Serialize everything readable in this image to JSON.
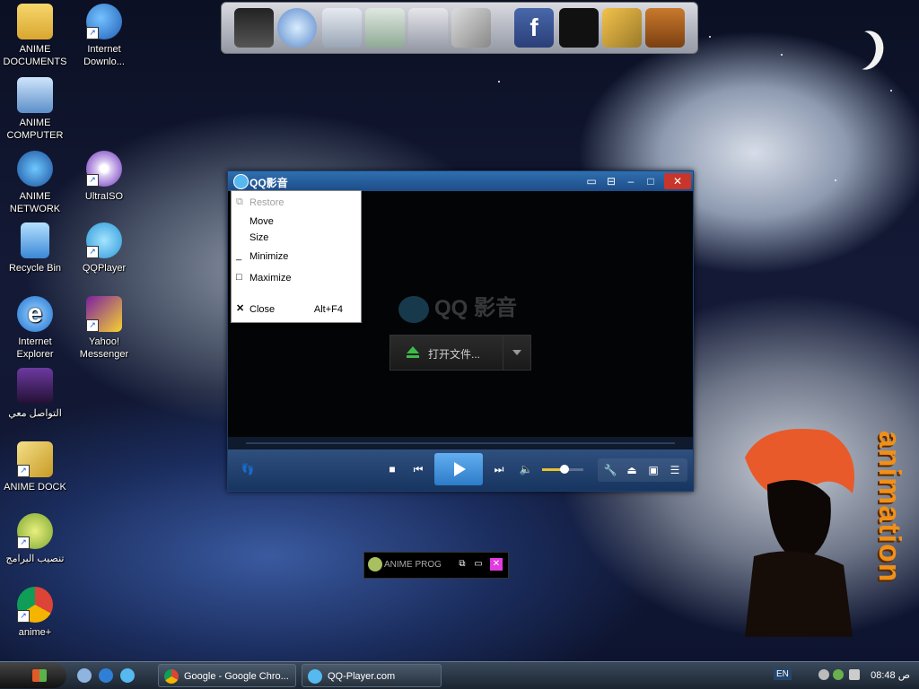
{
  "desktop": {
    "icons": [
      {
        "label": "ANIME\nDOCUMENTS",
        "icon": "folder-icon"
      },
      {
        "label": "Internet\nDownlo...",
        "icon": "download-manager-icon"
      },
      {
        "label": "ANIME\nCOMPUTER",
        "icon": "computer-icon"
      },
      {
        "label": "ANIME\nNETWORK",
        "icon": "network-icon"
      },
      {
        "label": "UltraISO",
        "icon": "disc-icon"
      },
      {
        "label": "Recycle Bin",
        "icon": "recycle-bin-icon"
      },
      {
        "label": "QQPlayer",
        "icon": "qqplayer-icon"
      },
      {
        "label": "Internet\nExplorer",
        "icon": "ie-icon"
      },
      {
        "label": "Yahoo!\nMessenger",
        "icon": "yahoo-icon"
      },
      {
        "label": "التواصل معي",
        "icon": "contact-folder-icon"
      },
      {
        "label": "ANIME DOCK",
        "icon": "dock-icon"
      },
      {
        "label": "تنصيب البرامج",
        "icon": "installer-icon"
      },
      {
        "label": "anime+",
        "icon": "chrome-icon"
      }
    ]
  },
  "dock": {
    "items": [
      "naruto-monitor-icon",
      "globe-icon",
      "folder-icon",
      "music-folder-icon",
      "pictures-folder-icon",
      "tools-icon",
      "facebook-icon",
      "tshirt-icon",
      "hammer-icon",
      "bucket-icon"
    ]
  },
  "qq": {
    "title": "QQ影音",
    "brand": "QQ 影音",
    "open_label": "打开文件...",
    "volume_level": 0.5,
    "title_buttons": [
      "chat-icon",
      "mini-mode-icon",
      "minimize-icon",
      "maximize-icon",
      "close-icon"
    ],
    "controls": [
      "footprint-icon",
      "stop-icon",
      "prev-icon",
      "play-icon",
      "next-icon",
      "volume-icon",
      "settings-icon",
      "eject-icon",
      "screen-icon",
      "playlist-icon"
    ]
  },
  "menu": {
    "items": [
      {
        "label": "Restore",
        "disabled": true,
        "icon": "restore-icon"
      },
      {
        "label": "Move"
      },
      {
        "label": "Size"
      },
      {
        "label": "Minimize",
        "icon": "minimize-icon"
      },
      {
        "label": "Maximize",
        "icon": "maximize-icon"
      },
      {
        "label": "Close",
        "shortcut": "Alt+F4",
        "icon": "close-icon"
      }
    ]
  },
  "anime_prog": {
    "label": "ANIME PROG"
  },
  "brand_vertical": "animation",
  "taskbar": {
    "tasks": [
      {
        "label": "Google - Google Chro...",
        "icon": "chrome-icon"
      },
      {
        "label": "QQ-Player.com",
        "icon": "qqplayer-icon"
      }
    ],
    "lang": "EN",
    "clock": "08:48 ص"
  }
}
